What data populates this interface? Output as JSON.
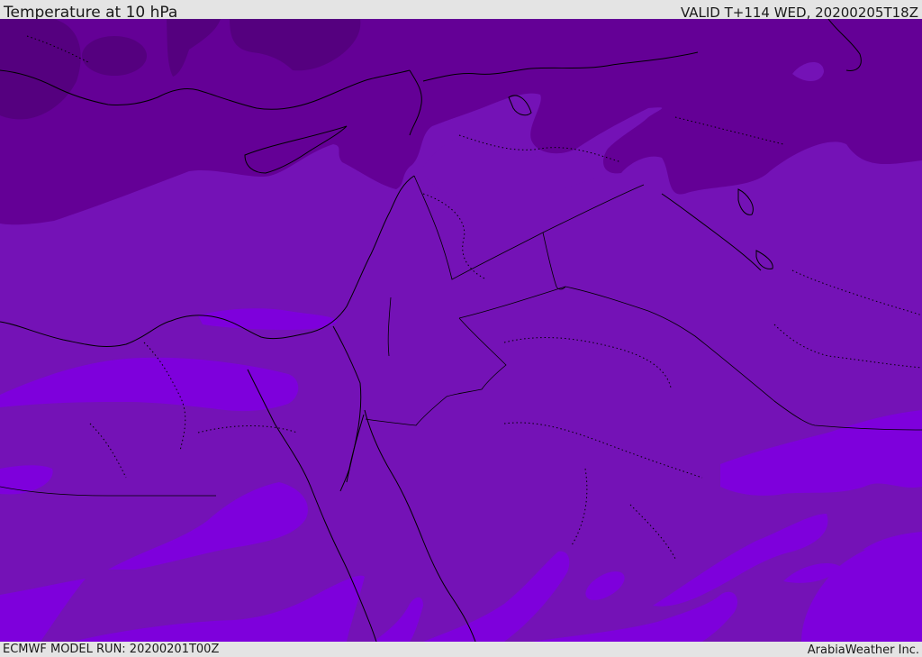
{
  "header": {
    "title": "Temperature at 10 hPa",
    "valid": "VALID T+114 WED, 20200205T18Z"
  },
  "footer": {
    "model_run": "ECMWF MODEL RUN: 20200201T00Z",
    "brand": "ArabiaWeather Inc."
  },
  "map": {
    "colors": {
      "ocean_base": "#7211b4",
      "darkest": "#55007f",
      "dark": "#640096",
      "mid": "#7412b6",
      "bright": "#7e00dc",
      "coast": "#000000"
    }
  }
}
